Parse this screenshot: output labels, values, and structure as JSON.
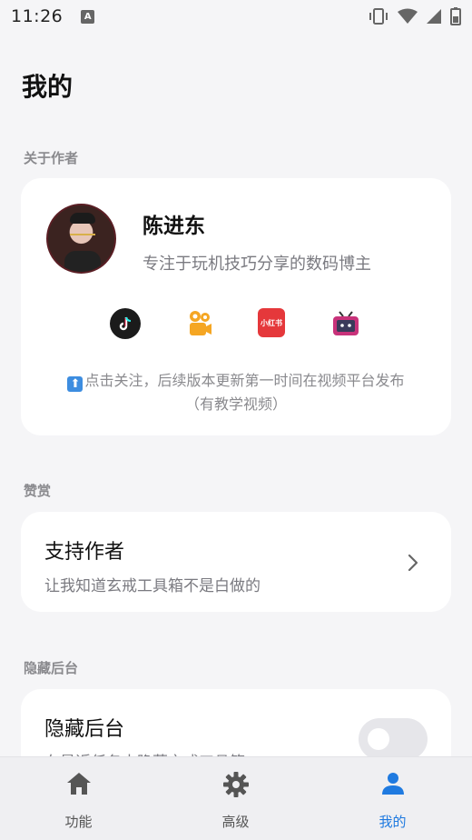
{
  "status_bar": {
    "time": "11:26",
    "notification_icon": "A"
  },
  "page": {
    "title": "我的"
  },
  "about_author": {
    "section_label": "关于作者",
    "name": "陈进东",
    "description": "专注于玩机技巧分享的数码博主",
    "socials": [
      {
        "name": "douyin-icon",
        "color": "#1b1b1b"
      },
      {
        "name": "kuaishou-icon",
        "color": "#f5a623"
      },
      {
        "name": "xiaohongshu-icon",
        "color": "#e5383b",
        "text": "小红书"
      },
      {
        "name": "bilibili-icon",
        "color": "#c8327a"
      }
    ],
    "follow_note_line1": "点击关注，后续版本更新第一时间在视频平台发布",
    "follow_note_line2": "（有教学视频）"
  },
  "reward": {
    "section_label": "赞赏",
    "title": "支持作者",
    "subtitle": "让我知道玄戒工具箱不是白做的"
  },
  "hide_background": {
    "section_label": "隐藏后台",
    "title": "隐藏后台",
    "subtitle": "在最近任务中隐藏玄戒工具箱",
    "toggle_on": false
  },
  "tabs": [
    {
      "label": "功能",
      "icon": "home-icon",
      "active": false
    },
    {
      "label": "高级",
      "icon": "gear-icon",
      "active": false
    },
    {
      "label": "我的",
      "icon": "person-icon",
      "active": true
    }
  ],
  "colors": {
    "accent": "#1f7ae0",
    "background": "#f5f5f7",
    "card": "#ffffff"
  }
}
